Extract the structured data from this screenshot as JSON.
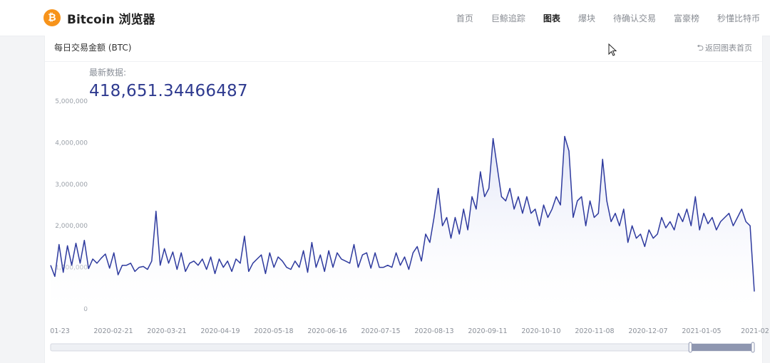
{
  "brand": {
    "logo_glyph": "₿",
    "name": "Bitcoin 浏览器",
    "logo_color": "#f7931a"
  },
  "nav": {
    "items": [
      {
        "label": "首页",
        "active": false
      },
      {
        "label": "巨鲸追踪",
        "active": false
      },
      {
        "label": "图表",
        "active": true
      },
      {
        "label": "爆块",
        "active": false
      },
      {
        "label": "待确认交易",
        "active": false
      },
      {
        "label": "富豪榜",
        "active": false
      },
      {
        "label": "秒懂比特币",
        "active": false
      }
    ]
  },
  "card": {
    "title": "每日交易金额 (BTC)",
    "back_label": "返回图表首页",
    "back_icon": "undo-arrow-icon",
    "latest_label": "最新数据:",
    "latest_value": "418,651.34466487"
  },
  "colors": {
    "line": "#2e3a9e",
    "area_top": "#dfe3f6",
    "accent": "#2e3a8f"
  },
  "chart_data": {
    "type": "area",
    "title": "每日交易金额 (BTC)",
    "ylim": [
      0,
      5000000
    ],
    "y_ticks": [
      "0",
      "1,000,000",
      "2,000,000",
      "3,000,000",
      "4,000,000",
      "5,000,000"
    ],
    "y_tick_values": [
      0,
      1000000,
      2000000,
      3000000,
      4000000,
      5000000
    ],
    "x_tick_labels": [
      "01-23",
      "2020-02-21",
      "2020-03-21",
      "2020-04-19",
      "2020-05-18",
      "2020-06-16",
      "2020-07-15",
      "2020-08-13",
      "2020-09-11",
      "2020-10-10",
      "2020-11-08",
      "2020-12-07",
      "2021-01-05",
      "2021-02"
    ],
    "x_range": [
      "2020-01-23",
      "2021-02-14"
    ],
    "series": [
      {
        "values": [
          1050000,
          780000,
          1550000,
          880000,
          1520000,
          1050000,
          1580000,
          1100000,
          1650000,
          970000,
          1200000,
          1100000,
          1220000,
          1320000,
          980000,
          1350000,
          820000,
          1050000,
          1050000,
          1100000,
          900000,
          1000000,
          1020000,
          950000,
          1150000,
          2350000,
          1050000,
          1450000,
          1100000,
          1370000,
          950000,
          1350000,
          900000,
          1100000,
          1150000,
          1050000,
          1200000,
          950000,
          1250000,
          850000,
          1200000,
          1000000,
          1150000,
          900000,
          1200000,
          1100000,
          1750000,
          900000,
          1100000,
          1200000,
          1300000,
          850000,
          1350000,
          1000000,
          1250000,
          1150000,
          1000000,
          950000,
          1150000,
          1000000,
          1400000,
          880000,
          1600000,
          1000000,
          1300000,
          900000,
          1400000,
          1000000,
          1350000,
          1200000,
          1150000,
          1100000,
          1550000,
          1000000,
          1300000,
          1350000,
          980000,
          1350000,
          1000000,
          1000000,
          1050000,
          1000000,
          1350000,
          1050000,
          1250000,
          950000,
          1350000,
          1500000,
          1150000,
          1800000,
          1600000,
          2200000,
          2900000,
          2000000,
          2200000,
          1700000,
          2200000,
          1800000,
          2400000,
          1900000,
          2700000,
          2400000,
          3300000,
          2700000,
          2900000,
          4100000,
          3400000,
          2700000,
          2600000,
          2900000,
          2400000,
          2700000,
          2300000,
          2700000,
          2300000,
          2400000,
          2000000,
          2500000,
          2200000,
          2400000,
          2700000,
          2500000,
          4150000,
          3800000,
          2200000,
          2600000,
          2700000,
          2000000,
          2600000,
          2200000,
          2300000,
          3600000,
          2600000,
          2100000,
          2300000,
          2000000,
          2400000,
          1600000,
          2000000,
          1700000,
          1800000,
          1500000,
          1900000,
          1700000,
          1800000,
          2200000,
          1950000,
          2100000,
          1900000,
          2300000,
          2100000,
          2400000,
          2000000,
          2700000,
          1900000,
          2300000,
          2050000,
          2200000,
          1900000,
          2100000,
          2200000,
          2300000,
          2000000,
          2200000,
          2400000,
          2100000,
          2000000,
          418651
        ]
      }
    ]
  },
  "scrollbar": {
    "thumb_start": 0.91,
    "thumb_end": 1.0
  }
}
